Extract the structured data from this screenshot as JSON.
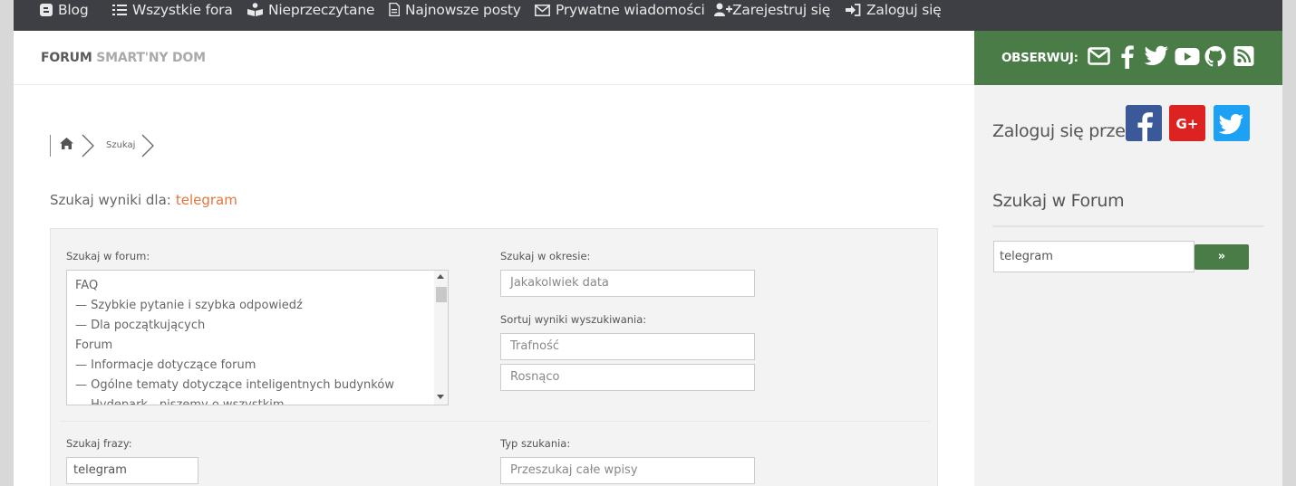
{
  "topnav": {
    "items": [
      {
        "label": "Blog",
        "icon": "blogger-icon"
      },
      {
        "label": "Wszystkie fora",
        "icon": "list-icon"
      },
      {
        "label": "Nieprzeczytane",
        "icon": "reading-icon"
      },
      {
        "label": "Najnowsze posty",
        "icon": "document-icon"
      },
      {
        "label": "Prywatne wiadomości",
        "icon": "envelope-icon"
      },
      {
        "label": "Zarejestruj się",
        "icon": "user-plus-icon"
      },
      {
        "label": "Zaloguj się",
        "icon": "sign-in-icon"
      }
    ]
  },
  "header": {
    "brand_main": "FORUM",
    "brand_sub": "SMART'NY DOM"
  },
  "breadcrumb": {
    "current": "Szukaj"
  },
  "results": {
    "label": "Szukaj wyniki dla:",
    "query": "telegram"
  },
  "search_form": {
    "forum_label": "Szukaj w forum:",
    "forum_options": [
      "FAQ",
      "— Szybkie pytanie i szybka odpowiedź",
      "— Dla początkujących",
      "Forum",
      "— Informacje dotyczące forum",
      "— Ogólne tematy dotyczące inteligentnych budynków",
      "— Hydepark - piszemy o wszystkim"
    ],
    "period_label": "Szukaj w okresie:",
    "period_value": "Jakakolwiek data",
    "sort_label": "Sortuj wyniki wyszukiwania:",
    "sort_value": "Trafność",
    "order_value": "Rosnąco",
    "phrase_label": "Szukaj frazy:",
    "phrase_value": "telegram",
    "type_label": "Typ szukania:",
    "type_value": "Przeszukaj całe wpisy"
  },
  "sidebar": {
    "follow_label": "OBSERWUJ:",
    "follow_icons": [
      "envelope-icon",
      "facebook-icon",
      "twitter-icon",
      "youtube-icon",
      "github-icon",
      "rss-icon"
    ],
    "login_via": "Zaloguj się przez",
    "social_login": [
      {
        "name": "facebook-login",
        "color": "#3b5998"
      },
      {
        "name": "google-plus-login",
        "color": "#dd2222"
      },
      {
        "name": "twitter-login",
        "color": "#1da1f2"
      }
    ],
    "search_title": "Szukaj w Forum",
    "search_value": "telegram",
    "search_button": "»"
  },
  "colors": {
    "accent_green": "#4a7c48",
    "query_orange": "#e2763d",
    "nav_bg": "#3e3f45"
  }
}
